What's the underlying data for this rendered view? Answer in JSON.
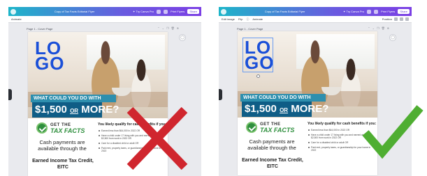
{
  "left": {
    "topbar": {
      "title": "Copy of Tax Facts Editorial Flyer",
      "try_canva_pro": "✦ Try Canva Pro",
      "print_label": "Print Flyers",
      "share_label": "Share"
    },
    "subbar": {
      "items": [
        "Animate"
      ]
    },
    "page_label": "Page 1 - Cover Page",
    "verdict": "incorrect"
  },
  "right": {
    "topbar": {
      "title": "Copy of Tax Facts Editorial Flyer",
      "try_canva_pro": "✦ Try Canva Pro",
      "print_label": "Print Flyers",
      "share_label": "Share"
    },
    "subbar": {
      "items": [
        "Edit image",
        "Flip",
        "ⓘ",
        "Animate"
      ],
      "position_label": "Position"
    },
    "page_label": "Page 1 - Cover Page",
    "verdict": "correct"
  },
  "flyer": {
    "logo_line1": "LO",
    "logo_line2": "GO",
    "banner_line1": "WHAT COULD YOU DO WITH",
    "banner_amount": "$1,500",
    "banner_or": "OR",
    "banner_more": "MORE?",
    "get_the": "GET THE",
    "tax_facts": "TAX FACTS",
    "cash_text": "Cash payments are available through the",
    "eitc_line1": "Earned Income Tax Credit,",
    "eitc_line2": "EITC",
    "right_heading": "You likely qualify for cash benefits if you:",
    "right_items": [
      "Earned less than $64,000 in 2022 OR",
      "Have a child under 17 living with you and earned at least $2,500 from work in 2022 OR",
      "Care for a disabled child or adult OR",
      "Paid rent, property taxes, or guardianship for your home in 2022"
    ]
  },
  "colors": {
    "canva_gradient_start": "#1cb5c9",
    "canva_gradient_end": "#7b3fe4",
    "logo_blue": "#1a4fd8",
    "banner_teal": "#2e8fae",
    "banner_navy": "#0f5d86",
    "tax_green": "#2f8f3e",
    "cross_red": "#d0262e",
    "check_green": "#4fae32"
  }
}
